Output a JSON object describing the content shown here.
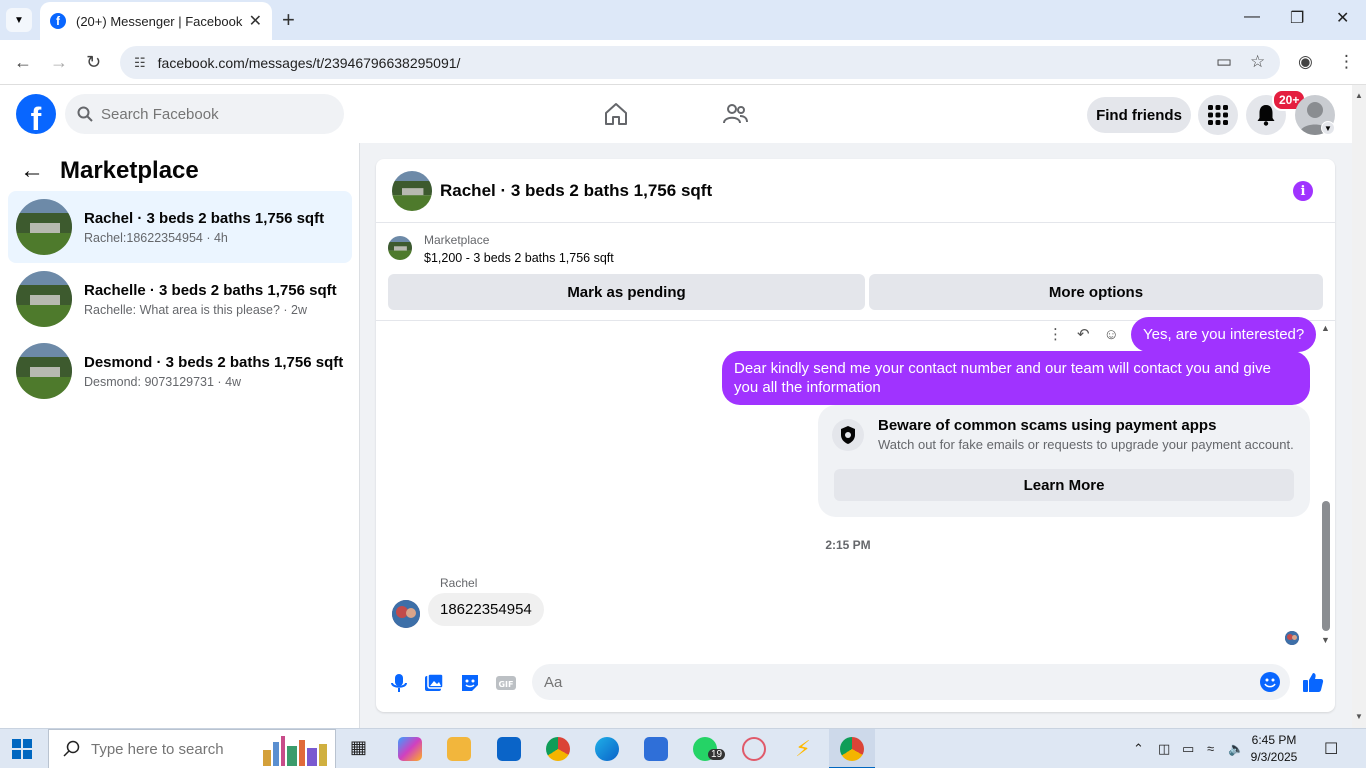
{
  "browser": {
    "tab_title": "(20+) Messenger | Facebook",
    "url": "facebook.com/messages/t/23946796638295091/"
  },
  "fbnav": {
    "search_placeholder": "Search Facebook",
    "find_friends": "Find friends",
    "notif_badge": "20+",
    "accent": "#0866ff"
  },
  "sidebar": {
    "title": "Marketplace",
    "conversations": [
      {
        "name": "Rachel · 3 beds 2 baths 1,756 sqft",
        "preview": "Rachel:18622354954 · 4h"
      },
      {
        "name": "Rachelle · 3 beds 2 baths 1,756 sqft",
        "preview": "Rachelle: What area is this please? · 2w"
      },
      {
        "name": "Desmond · 3 beds 2 baths 1,756 sqft",
        "preview": "Desmond: 9073129731 · 4w"
      }
    ]
  },
  "chat": {
    "title": "Rachel · 3 beds 2 baths 1,756 sqft",
    "marketplace_label": "Marketplace",
    "listing": "$1,200 - 3 beds 2 baths 1,756 sqft",
    "mark_pending": "Mark as pending",
    "more_options": "More options",
    "messages": {
      "out_1": "Yes, are you interested?",
      "out_2": "Dear kindly send me your contact number and our team will contact you and give you all the information",
      "scam_title": "Beware of common scams using payment apps",
      "scam_desc": "Watch out for fake emails or requests to upgrade your payment account.",
      "learn_more": "Learn More",
      "timestamp": "2:15 PM",
      "sender": "Rachel",
      "in_1": "18622354954"
    },
    "composer_placeholder": "Aa",
    "bubble_color": "#a033ff"
  },
  "taskbar": {
    "search_placeholder": "Type here to search",
    "whatsapp_badge": "19",
    "time": "6:45 PM",
    "date": "9/3/2025"
  }
}
